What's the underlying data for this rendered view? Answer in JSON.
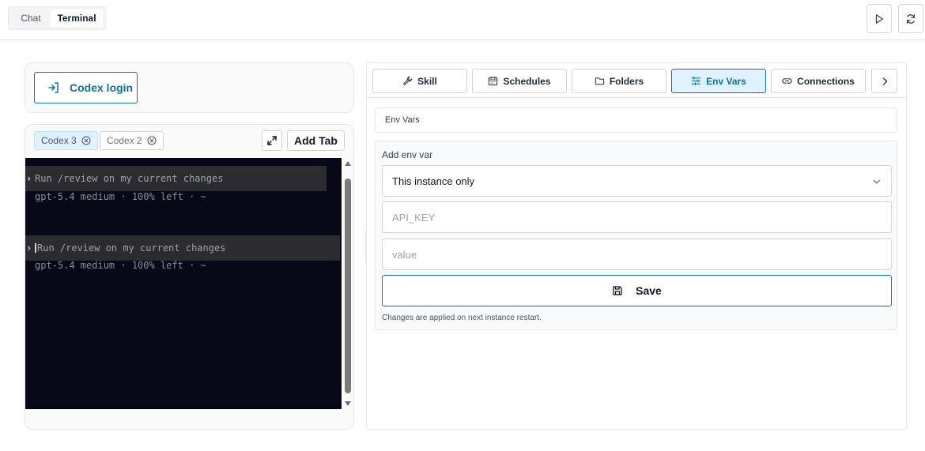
{
  "topbar": {
    "modes": {
      "chat": "Chat",
      "terminal": "Terminal",
      "selected": "Terminal"
    },
    "actions": [
      "play-icon",
      "refresh-icon"
    ]
  },
  "login": {
    "label": "Codex login",
    "icon": "login-icon"
  },
  "terminal_tabs": {
    "tabs": [
      {
        "label": "Codex 3",
        "active": true
      },
      {
        "label": "Codex 2",
        "active": false
      }
    ],
    "add_tab_label": "Add Tab"
  },
  "terminal": {
    "lines": [
      {
        "prompt": "›",
        "text": "Run /review on my current changes",
        "meta": "gpt-5.4 medium · 100% left · ~"
      },
      {
        "prompt": "›",
        "text": "Run /review on my current changes",
        "meta": "gpt-5.4 medium · 100% left · ~"
      }
    ]
  },
  "right_tabs": {
    "tabs": [
      {
        "label": "Skill",
        "icon": "wrench-icon"
      },
      {
        "label": "Schedules",
        "icon": "calendar-icon"
      },
      {
        "label": "Folders",
        "icon": "folder-icon"
      },
      {
        "label": "Env Vars",
        "icon": "sliders-icon"
      },
      {
        "label": "Connections",
        "icon": "link-icon"
      }
    ],
    "active": "Env Vars"
  },
  "env": {
    "section_title": "Env Vars",
    "add_label": "Add env var",
    "scope_value": "This instance only",
    "key_placeholder": "API_KEY",
    "value_placeholder": "value",
    "save_label": "Save",
    "note": "Changes are applied on next instance restart."
  },
  "colors": {
    "accent": "#0e7490",
    "active_bg": "#e0f2fe",
    "terminal_bg": "#050816"
  }
}
